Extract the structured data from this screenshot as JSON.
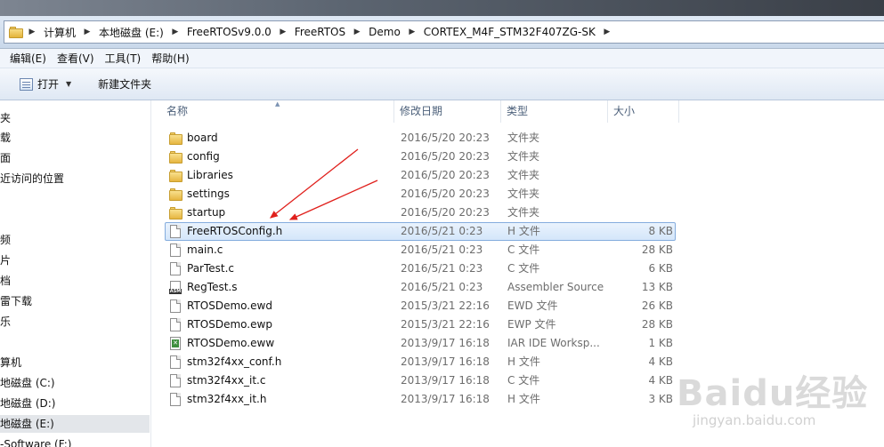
{
  "address": {
    "crumbs": [
      "计算机",
      "本地磁盘 (E:)",
      "FreeRTOSv9.0.0",
      "FreeRTOS",
      "Demo",
      "CORTEX_M4F_STM32F407ZG-SK"
    ]
  },
  "menu": {
    "items": [
      "编辑(E)",
      "查看(V)",
      "工具(T)",
      "帮助(H)"
    ]
  },
  "toolbar": {
    "open_label": "打开",
    "new_folder_label": "新建文件夹"
  },
  "nav": {
    "items": [
      "夹",
      "载",
      "面",
      "近访问的位置",
      "频",
      "片",
      "档",
      "雷下载",
      "乐",
      "算机",
      "地磁盘 (C:)",
      "地磁盘 (D:)",
      "地磁盘 (E:)",
      "-Software (F:)"
    ],
    "selected": "地磁盘 (E:)"
  },
  "columns": {
    "name": "名称",
    "date": "修改日期",
    "type": "类型",
    "size": "大小"
  },
  "files": [
    {
      "name": "board",
      "date": "2016/5/20 20:23",
      "type": "文件夹",
      "size": "",
      "icon": "folder-icon"
    },
    {
      "name": "config",
      "date": "2016/5/20 20:23",
      "type": "文件夹",
      "size": "",
      "icon": "folder-icon"
    },
    {
      "name": "Libraries",
      "date": "2016/5/20 20:23",
      "type": "文件夹",
      "size": "",
      "icon": "folder-icon"
    },
    {
      "name": "settings",
      "date": "2016/5/20 20:23",
      "type": "文件夹",
      "size": "",
      "icon": "folder-icon"
    },
    {
      "name": "startup",
      "date": "2016/5/20 20:23",
      "type": "文件夹",
      "size": "",
      "icon": "folder-icon"
    },
    {
      "name": "FreeRTOSConfig.h",
      "date": "2016/5/21 0:23",
      "type": "H 文件",
      "size": "8 KB",
      "icon": "file-icon",
      "selected": true
    },
    {
      "name": "main.c",
      "date": "2016/5/21 0:23",
      "type": "C 文件",
      "size": "28 KB",
      "icon": "file-icon"
    },
    {
      "name": "ParTest.c",
      "date": "2016/5/21 0:23",
      "type": "C 文件",
      "size": "6 KB",
      "icon": "file-icon"
    },
    {
      "name": "RegTest.s",
      "date": "2016/5/21 0:23",
      "type": "Assembler Source",
      "size": "13 KB",
      "icon": "assembler-file-icon"
    },
    {
      "name": "RTOSDemo.ewd",
      "date": "2015/3/21 22:16",
      "type": "EWD 文件",
      "size": "26 KB",
      "icon": "file-icon"
    },
    {
      "name": "RTOSDemo.ewp",
      "date": "2015/3/21 22:16",
      "type": "EWP 文件",
      "size": "28 KB",
      "icon": "file-icon"
    },
    {
      "name": "RTOSDemo.eww",
      "date": "2013/9/17 16:18",
      "type": "IAR IDE Worksp...",
      "size": "1 KB",
      "icon": "iar-workspace-icon"
    },
    {
      "name": "stm32f4xx_conf.h",
      "date": "2013/9/17 16:18",
      "type": "H 文件",
      "size": "4 KB",
      "icon": "file-icon"
    },
    {
      "name": "stm32f4xx_it.c",
      "date": "2013/9/17 16:18",
      "type": "C 文件",
      "size": "4 KB",
      "icon": "file-icon"
    },
    {
      "name": "stm32f4xx_it.h",
      "date": "2013/9/17 16:18",
      "type": "H 文件",
      "size": "3 KB",
      "icon": "file-icon"
    }
  ],
  "annotation": {
    "arrow_color": "#e0201c"
  },
  "watermark": {
    "logo": "Baidu经验",
    "url": "jingyan.baidu.com"
  }
}
